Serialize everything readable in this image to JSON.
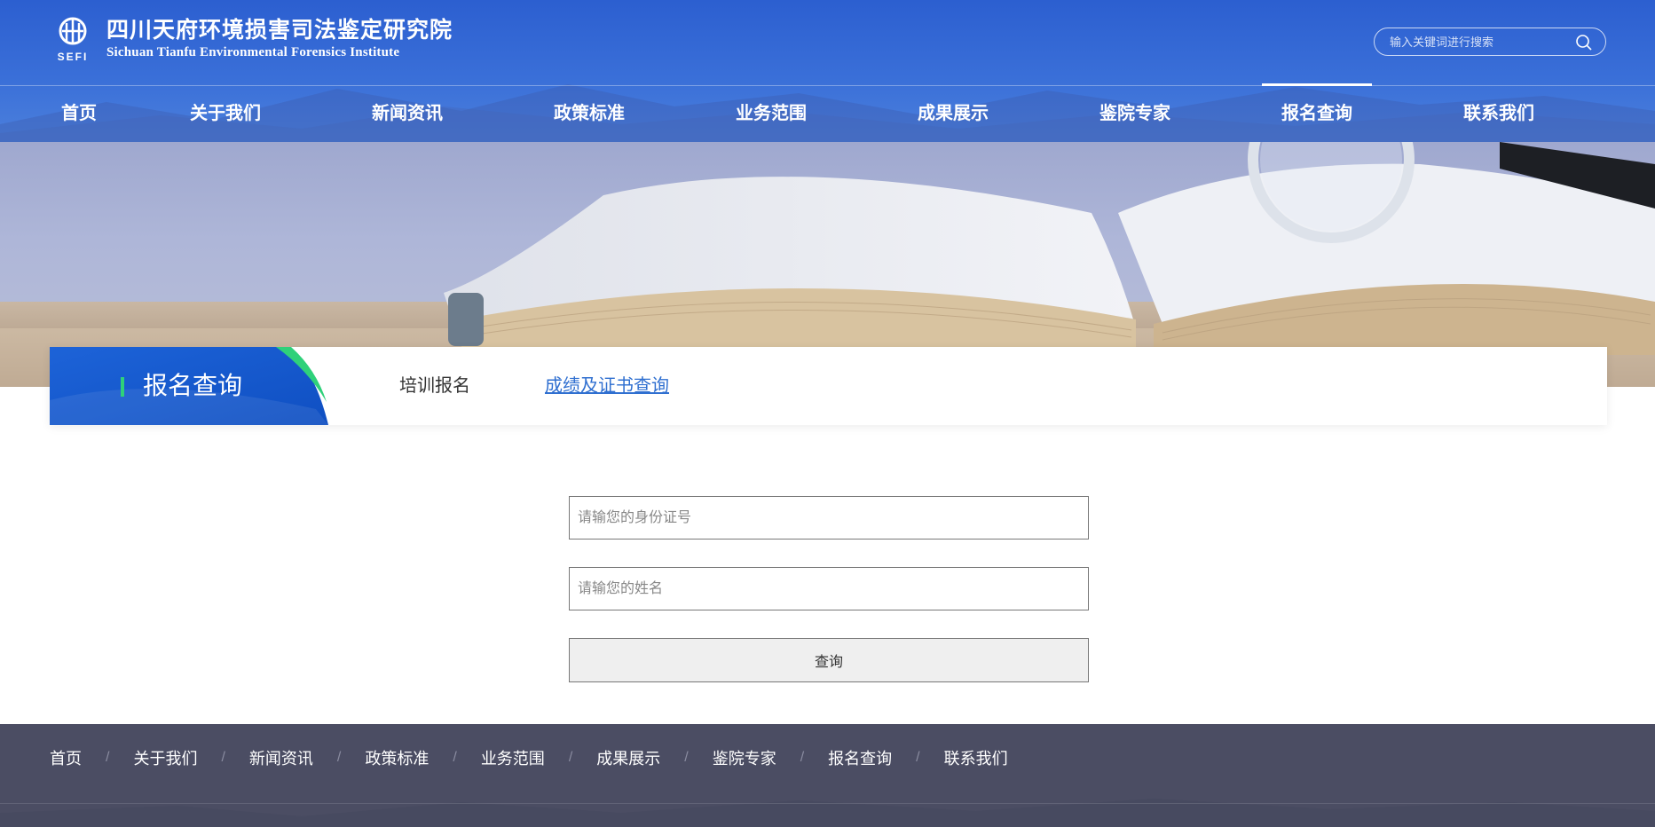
{
  "header": {
    "logo_cn": "四川天府环境损害司法鉴定研究院",
    "logo_en": "Sichuan Tianfu Environmental Forensics Institute",
    "logo_mark_text": "SEFI",
    "search_placeholder": "输入关键词进行搜索"
  },
  "nav": {
    "items": [
      {
        "label": "首页"
      },
      {
        "label": "关于我们"
      },
      {
        "label": "新闻资讯"
      },
      {
        "label": "政策标准"
      },
      {
        "label": "业务范围"
      },
      {
        "label": "成果展示"
      },
      {
        "label": "鉴院专家"
      },
      {
        "label": "报名查询",
        "active": true
      },
      {
        "label": "联系我们"
      }
    ]
  },
  "subpanel": {
    "title": "报名查询",
    "tabs": [
      {
        "label": "培训报名"
      },
      {
        "label": "成绩及证书查询",
        "active": true
      }
    ]
  },
  "form": {
    "id_placeholder": "请输您的身份证号",
    "name_placeholder": "请输您的姓名",
    "submit_label": "查询"
  },
  "footer": {
    "items": [
      "首页",
      "关于我们",
      "新闻资讯",
      "政策标准",
      "业务范围",
      "成果展示",
      "鉴院专家",
      "报名查询",
      "联系我们"
    ],
    "separator": "/"
  },
  "colors": {
    "header_blue": "#2c5fd0",
    "accent_green": "#2fd17a",
    "active_link": "#2f6fd0",
    "footer_bg": "#4b4d63"
  }
}
